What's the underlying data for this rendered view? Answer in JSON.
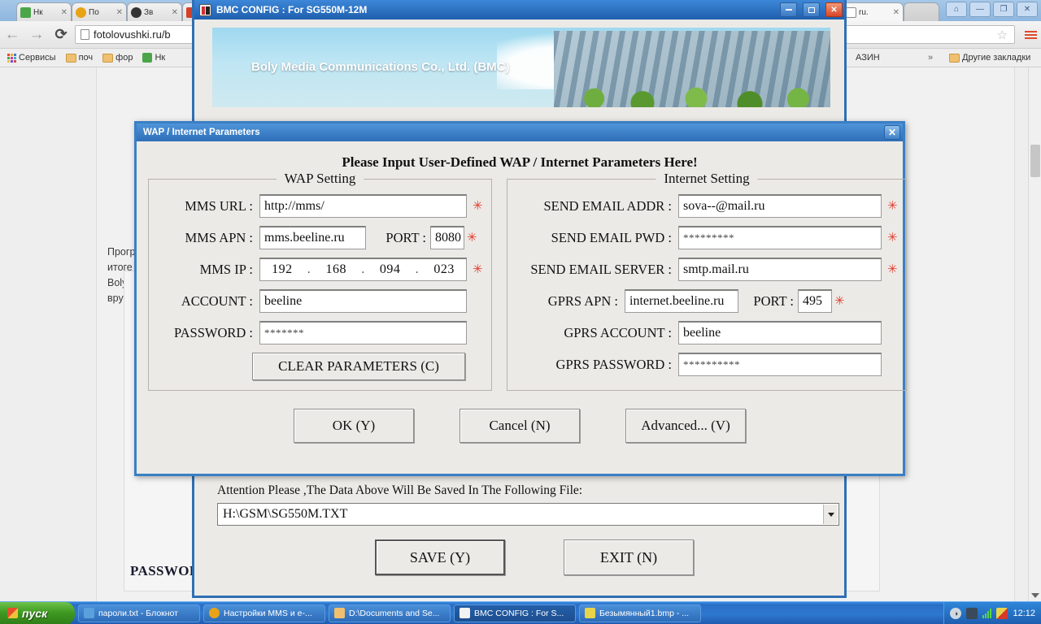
{
  "browser": {
    "tabs": [
      {
        "label": "Нк",
        "icon": "green-refresh-icon",
        "color": "#4aa648"
      },
      {
        "label": "По",
        "icon": "orange-circle-icon",
        "color": "#e8a317"
      },
      {
        "label": "Зв",
        "icon": "dark-globe-icon",
        "color": "#333333"
      },
      {
        "label": "",
        "icon": "red-site-icon",
        "color": "#d4402a"
      },
      {
        "label": "ru.",
        "icon": "page-icon",
        "color": "#ffffff"
      }
    ],
    "tab_close_glyph": "✕",
    "nav": {
      "back": "←",
      "forward": "→",
      "reload": "⟳"
    },
    "url": "fotolovushki.ru/b",
    "star": "☆",
    "bookmarks": [
      {
        "label": "Сервисы",
        "icon": "apps-grid-icon"
      },
      {
        "label": "поч",
        "icon": "folder-icon"
      },
      {
        "label": "фор",
        "icon": "folder-icon"
      },
      {
        "label": "Нк",
        "icon": "green-refresh-icon"
      },
      {
        "label": "АЗИН",
        "icon": "none"
      }
    ],
    "bookmarks_overflow": "»",
    "other_bookmarks": "Другие закладки",
    "window_controls": {
      "user": "⌂",
      "minimize": "—",
      "restore": "❐",
      "close": "✕"
    },
    "page": {
      "lines": [
        "Прогр",
        "итоге",
        "Bolyn",
        "вручн"
      ],
      "bullet": "•",
      "password_label": "PASSWOR"
    }
  },
  "bmc_window": {
    "title": "BMC CONFIG : For SG550M-12M",
    "icon": "bmc-app-icon",
    "controls": {
      "minimize": "minimize-icon",
      "maximize": "maximize-icon",
      "close": "close-icon"
    },
    "banner_text": "Boly Media Communications Co., Ltd. (BMC)",
    "attention": "Attention Please ,The Data Above Will Be Saved In The Following  File:",
    "file_path": "H:\\GSM\\SG550M.TXT",
    "file_dropdown_icon": "chevron-down-icon",
    "save_label": "SAVE (Y)",
    "exit_label": "EXIT (N)"
  },
  "dialog": {
    "title": "WAP / Internet Parameters",
    "close_glyph": "✕",
    "heading": "Please Input User-Defined WAP / Internet Parameters Here!",
    "required_marker": "✳",
    "wap": {
      "group_title": "WAP Setting",
      "mms_url_label": "MMS URL :",
      "mms_url_value": "http://mms/",
      "mms_apn_label": "MMS APN :",
      "mms_apn_value": "mms.beeline.ru",
      "port_label": "PORT :",
      "port_value": "8080",
      "mms_ip_label": "MMS IP :",
      "ip_octets": [
        "192",
        "168",
        "094",
        "023"
      ],
      "ip_dot": ".",
      "account_label": "ACCOUNT :",
      "account_value": "beeline",
      "password_label": "PASSWORD :",
      "password_value": "*******",
      "clear_label": "CLEAR PARAMETERS (C)"
    },
    "internet": {
      "group_title": "Internet Setting",
      "email_addr_label": "SEND EMAIL ADDR :",
      "email_addr_value": "sova--@mail.ru",
      "email_pwd_label": "SEND EMAIL PWD :",
      "email_pwd_value": "*********",
      "email_server_label": "SEND EMAIL SERVER :",
      "email_server_value": "smtp.mail.ru",
      "gprs_apn_label": "GPRS APN :",
      "gprs_apn_value": "internet.beeline.ru",
      "gprs_port_label": "PORT :",
      "gprs_port_value": "495",
      "gprs_account_label": "GPRS ACCOUNT :",
      "gprs_account_value": "beeline",
      "gprs_password_label": "GPRS PASSWORD :",
      "gprs_password_value": "**********"
    },
    "ok_label": "OK (Y)",
    "cancel_label": "Cancel (N)",
    "advanced_label": "Advanced... (V)"
  },
  "taskbar": {
    "start_label": "пуск",
    "items": [
      {
        "label": "пароли.txt - Блокнот",
        "icon": "notepad-icon",
        "color": "#5aa0dc",
        "selected": false
      },
      {
        "label": "Настройки MMS и e-...",
        "icon": "chrome-icon",
        "color": "#e8a317",
        "selected": false
      },
      {
        "label": "D:\\Documents and Se...",
        "icon": "folder-icon",
        "color": "#f0c070",
        "selected": false
      },
      {
        "label": "BMC CONFIG : For S...",
        "icon": "bmc-app-icon",
        "color": "#d83a2a",
        "selected": true
      },
      {
        "label": "Безымянный1.bmp - ...",
        "icon": "paint-icon",
        "color": "#e8d44a",
        "selected": false
      }
    ],
    "tray": {
      "clock": "12:12",
      "icons": [
        "volume-icon",
        "network-icon",
        "signal-icon",
        "shield-icon"
      ]
    }
  }
}
